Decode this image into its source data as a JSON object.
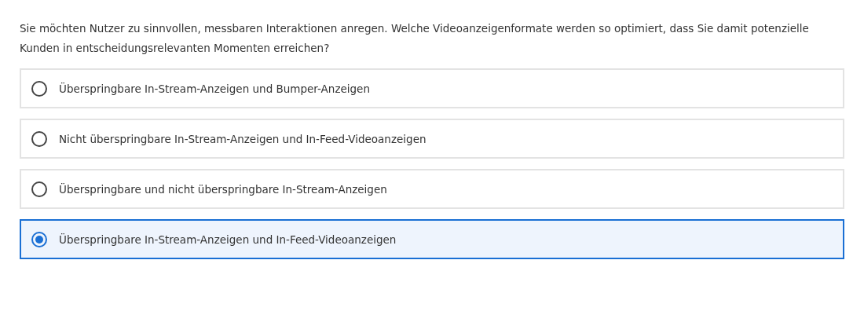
{
  "question": "Sie möchten Nutzer zu sinnvollen, messbaren Interaktionen anregen. Welche Videoanzeigenformate werden so optimiert, dass Sie damit potenzielle Kunden in entscheidungsrelevanten Momenten erreichen?",
  "options": [
    {
      "label": "Überspringbare In-Stream-Anzeigen und Bumper-Anzeigen",
      "selected": false
    },
    {
      "label": "Nicht überspringbare In-Stream-Anzeigen und In-Feed-Videoanzeigen",
      "selected": false
    },
    {
      "label": "Überspringbare und nicht überspringbare In-Stream-Anzeigen",
      "selected": false
    },
    {
      "label": "Überspringbare In-Stream-Anzeigen und In-Feed-Videoanzeigen",
      "selected": true
    }
  ]
}
